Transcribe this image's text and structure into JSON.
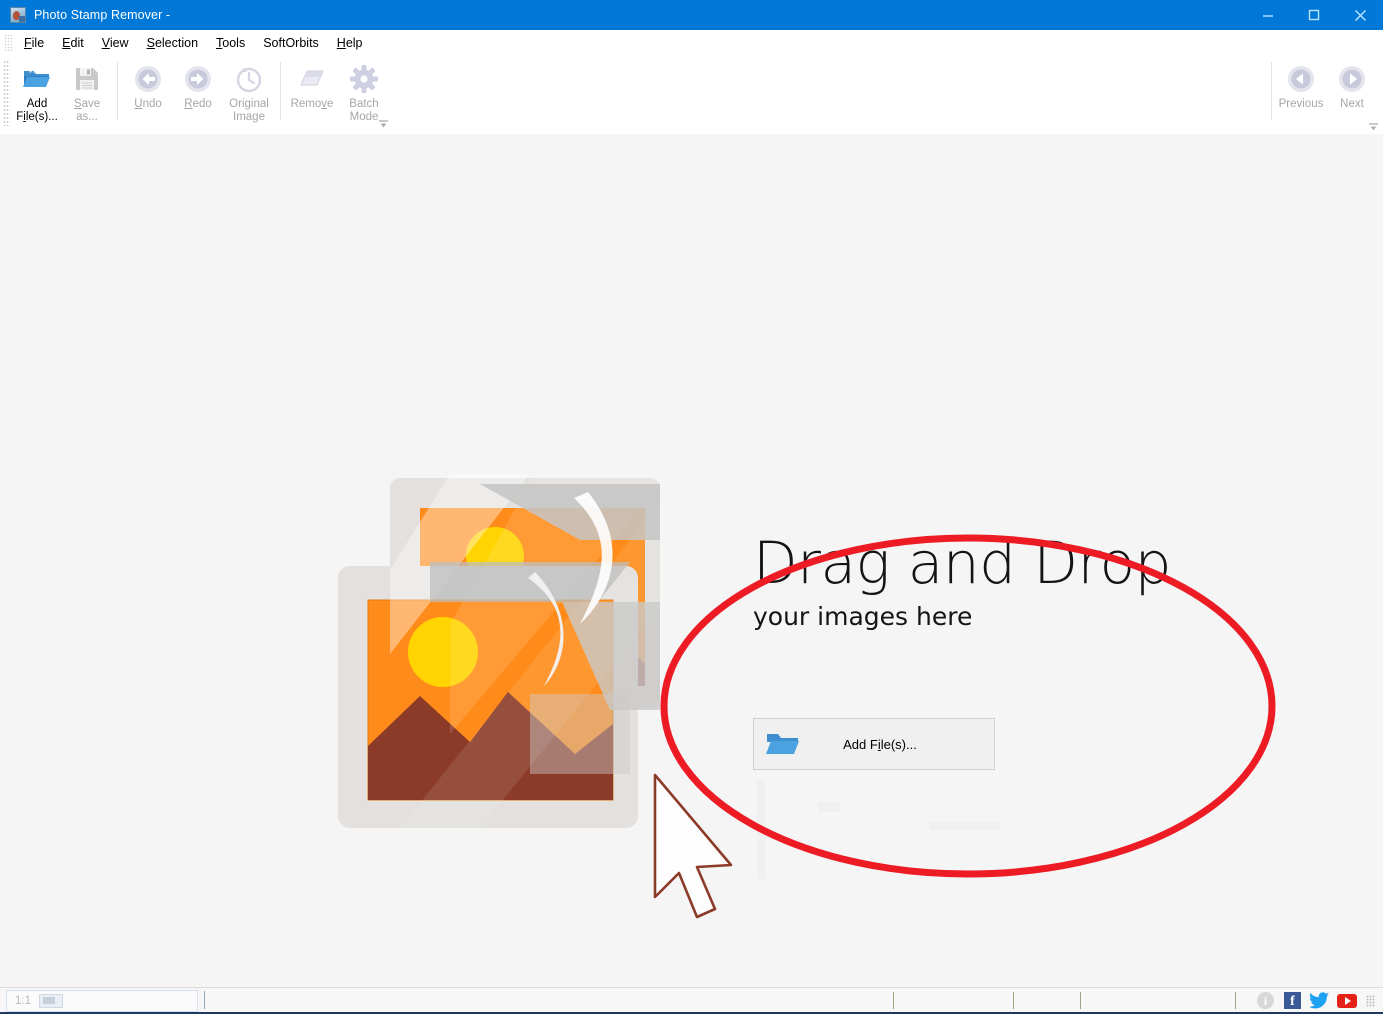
{
  "window": {
    "title": "Photo Stamp Remover - ",
    "app_icon": "photo-app-icon",
    "minimize_label": "Minimize",
    "maximize_label": "Maximize",
    "close_label": "Close",
    "titlebar_color": "#0078d7"
  },
  "menubar": {
    "items": [
      {
        "label": "File",
        "mnemonic": "F"
      },
      {
        "label": "Edit",
        "mnemonic": "E"
      },
      {
        "label": "View",
        "mnemonic": "V"
      },
      {
        "label": "Selection",
        "mnemonic": "S"
      },
      {
        "label": "Tools",
        "mnemonic": "T"
      },
      {
        "label": "SoftOrbits",
        "mnemonic": ""
      },
      {
        "label": "Help",
        "mnemonic": "H"
      }
    ]
  },
  "toolbar": {
    "add_files": {
      "line1": "Add",
      "line2": "File(s)...",
      "icon": "open-folder-blue-icon",
      "enabled": true
    },
    "save_as": {
      "line1": "Save",
      "line2": "as...",
      "icon": "floppy-disk-icon",
      "enabled": false
    },
    "undo": {
      "line1": "Undo",
      "line2": "",
      "icon": "undo-arrow-icon",
      "enabled": false
    },
    "redo": {
      "line1": "Redo",
      "line2": "",
      "icon": "redo-arrow-icon",
      "enabled": false
    },
    "original_image": {
      "line1": "Original",
      "line2": "Image",
      "icon": "clock-history-icon",
      "enabled": false
    },
    "remove": {
      "line1": "Remove",
      "line2": "",
      "icon": "eraser-icon",
      "enabled": false
    },
    "batch_mode": {
      "line1": "Batch",
      "line2": "Mode",
      "icon": "gear-icon",
      "enabled": false
    },
    "previous": {
      "line1": "Previous",
      "line2": "",
      "icon": "arrow-left-circle-icon",
      "enabled": false
    },
    "next": {
      "line1": "Next",
      "line2": "",
      "icon": "arrow-right-circle-icon",
      "enabled": false
    },
    "overflow_label": "More toolbar commands"
  },
  "canvas": {
    "dropzone": {
      "title": "Drag and Drop",
      "subtitle": "your images here",
      "button_label": "Add File(s)...",
      "button_icon": "open-folder-blue-icon",
      "placeholder_art": "stacked-photos-illustration",
      "cursor_art": "mouse-pointer-illustration"
    },
    "annotation": {
      "shape": "ellipse",
      "color": "#ed1c24",
      "stroke_width": 7
    },
    "background_color": "#f5f5f5"
  },
  "statusbar": {
    "zoom": "1:1",
    "zoom_icon": "fit-screen-icon",
    "info_label": "i",
    "facebook_label": "f",
    "twitter_label": "Twitter",
    "youtube_label": "YouTube",
    "accent_color": "#1f3864"
  }
}
